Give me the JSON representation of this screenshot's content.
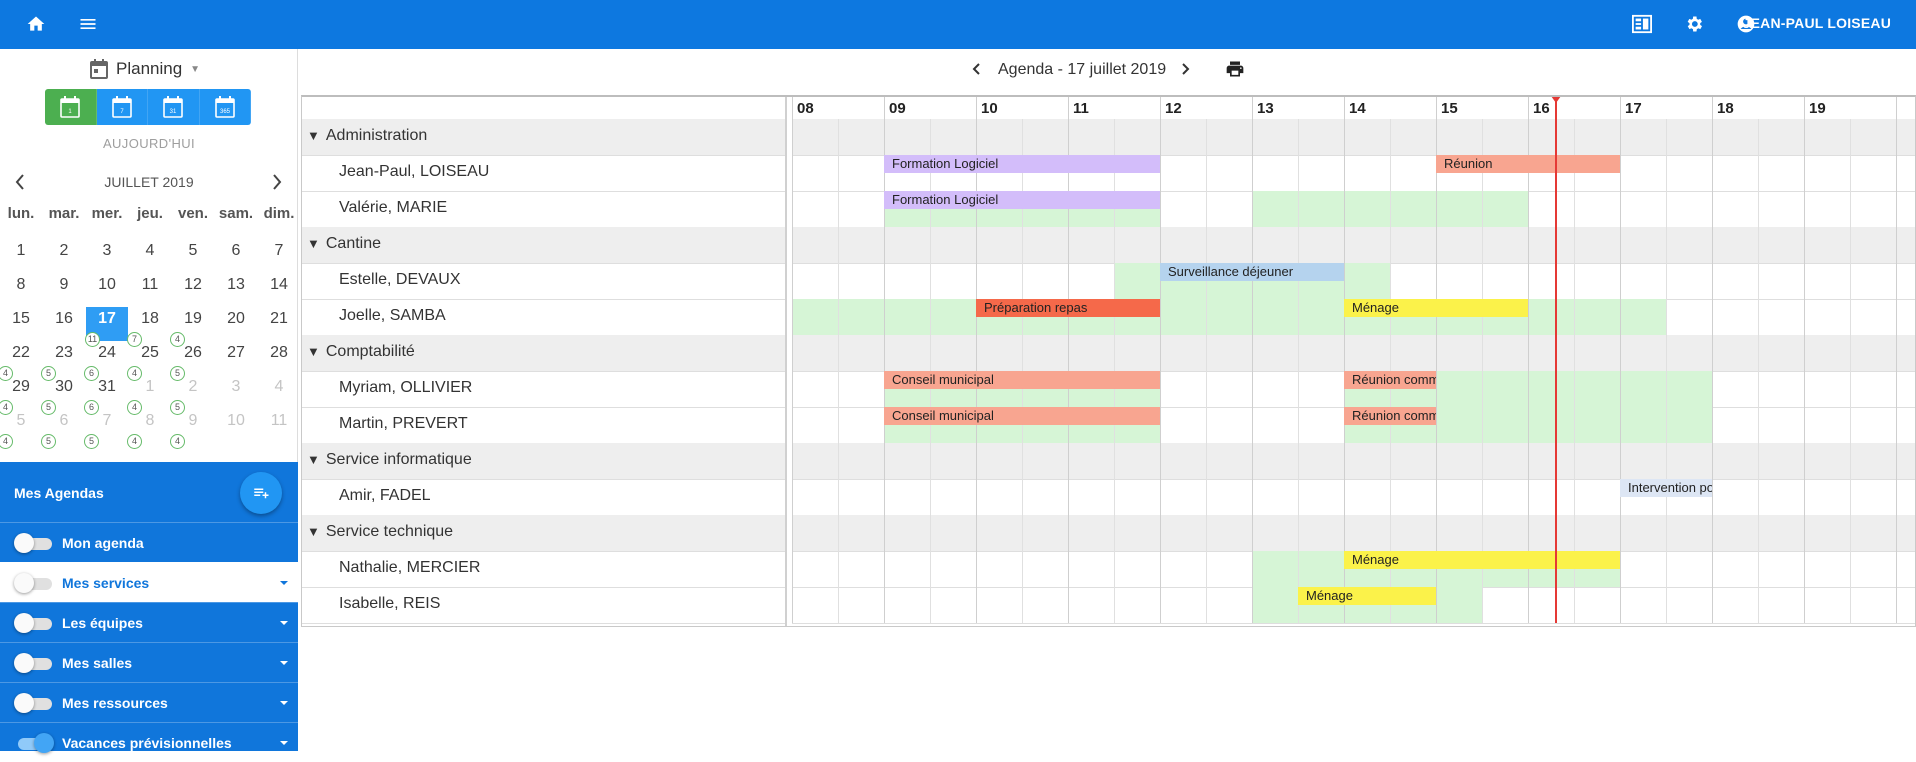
{
  "appbar": {
    "user_name": "JEAN-PAUL LOISEAU",
    "color": "#0d78e0"
  },
  "sidebar": {
    "view_select": "Planning",
    "view_buttons": [
      {
        "name": "day-view-button",
        "sub": "1",
        "active": true
      },
      {
        "name": "week-view-button",
        "sub": "7",
        "active": false
      },
      {
        "name": "month-view-button",
        "sub": "31",
        "active": false
      },
      {
        "name": "year-view-button",
        "sub": "365",
        "active": false
      }
    ],
    "today_label": "AUJOURD'HUI",
    "month_label": "JUILLET 2019",
    "weekdays": [
      "lun.",
      "mar.",
      "mer.",
      "jeu.",
      "ven.",
      "sam.",
      "dim."
    ],
    "weeks": [
      [
        {
          "d": "1"
        },
        {
          "d": "2"
        },
        {
          "d": "3"
        },
        {
          "d": "4"
        },
        {
          "d": "5"
        },
        {
          "d": "6"
        },
        {
          "d": "7"
        }
      ],
      [
        {
          "d": "8"
        },
        {
          "d": "9"
        },
        {
          "d": "10"
        },
        {
          "d": "11"
        },
        {
          "d": "12"
        },
        {
          "d": "13"
        },
        {
          "d": "14"
        }
      ],
      [
        {
          "d": "15"
        },
        {
          "d": "16"
        },
        {
          "d": "17",
          "today": true,
          "badge": "11"
        },
        {
          "d": "18",
          "badge": "7"
        },
        {
          "d": "19",
          "badge": "4"
        },
        {
          "d": "20"
        },
        {
          "d": "21"
        }
      ],
      [
        {
          "d": "22",
          "badge": "4"
        },
        {
          "d": "23",
          "badge": "5"
        },
        {
          "d": "24",
          "badge": "6"
        },
        {
          "d": "25",
          "badge": "4"
        },
        {
          "d": "26",
          "badge": "5"
        },
        {
          "d": "27"
        },
        {
          "d": "28"
        }
      ],
      [
        {
          "d": "29",
          "badge": "4"
        },
        {
          "d": "30",
          "badge": "5"
        },
        {
          "d": "31",
          "badge": "6"
        },
        {
          "d": "1",
          "other": true,
          "badge": "4"
        },
        {
          "d": "2",
          "other": true,
          "badge": "5"
        },
        {
          "d": "3",
          "other": true
        },
        {
          "d": "4",
          "other": true
        }
      ],
      [
        {
          "d": "5",
          "other": true,
          "badge": "4"
        },
        {
          "d": "6",
          "other": true,
          "badge": "5"
        },
        {
          "d": "7",
          "other": true,
          "badge": "5"
        },
        {
          "d": "8",
          "other": true,
          "badge": "4"
        },
        {
          "d": "9",
          "other": true,
          "badge": "4"
        },
        {
          "d": "10",
          "other": true
        },
        {
          "d": "11",
          "other": true
        }
      ]
    ],
    "mes_agendas_title": "Mes Agendas",
    "agendas": [
      {
        "label": "Mon agenda",
        "on": false,
        "caret": false,
        "selected": false
      },
      {
        "label": "Mes services",
        "on": false,
        "caret": true,
        "selected": true
      },
      {
        "label": "Les équipes",
        "on": false,
        "caret": true,
        "selected": false
      },
      {
        "label": "Mes salles",
        "on": false,
        "caret": true,
        "selected": false
      },
      {
        "label": "Mes ressources",
        "on": false,
        "caret": true,
        "selected": false
      },
      {
        "label": "Vacances prévisionnelles",
        "on": true,
        "caret": true,
        "selected": false
      }
    ]
  },
  "main": {
    "title": "Agenda - 17 juillet 2019",
    "hours": [
      "08",
      "09",
      "10",
      "11",
      "12",
      "13",
      "14",
      "15",
      "16",
      "17",
      "18",
      "19"
    ],
    "now_hour": 16.3,
    "groups": [
      {
        "name": "Administration",
        "people": [
          {
            "name": "Jean-Paul, LOISEAU",
            "avail": [],
            "events": [
              {
                "title": "Formation Logiciel",
                "start": 9,
                "end": 12,
                "color": "#d3bdfa"
              },
              {
                "title": "Réunion",
                "start": 15,
                "end": 17,
                "color": "#f8a590"
              }
            ]
          },
          {
            "name": "Valérie, MARIE",
            "avail": [
              [
                9,
                12
              ],
              [
                13,
                16
              ]
            ],
            "events": [
              {
                "title": "Formation Logiciel",
                "start": 9,
                "end": 12,
                "color": "#d3bdfa"
              }
            ]
          }
        ]
      },
      {
        "name": "Cantine",
        "people": [
          {
            "name": "Estelle, DEVAUX",
            "avail": [
              [
                11.5,
                14.5
              ]
            ],
            "events": [
              {
                "title": "Surveillance déjeuner",
                "start": 12,
                "end": 14,
                "color": "#b5d3ee"
              }
            ]
          },
          {
            "name": "Joelle, SAMBA",
            "avail": [
              [
                8,
                17.5
              ]
            ],
            "events": [
              {
                "title": "Préparation repas",
                "start": 10,
                "end": 12,
                "color": "#f5694a"
              },
              {
                "title": "Ménage",
                "start": 14,
                "end": 16,
                "color": "#fbf24a"
              }
            ]
          }
        ]
      },
      {
        "name": "Comptabilité",
        "people": [
          {
            "name": "Myriam, OLLIVIER",
            "avail": [
              [
                9,
                12
              ],
              [
                14,
                18
              ]
            ],
            "events": [
              {
                "title": "Conseil municipal",
                "start": 9,
                "end": 12,
                "color": "#f8a590"
              },
              {
                "title": "Réunion commission",
                "start": 14,
                "end": 15,
                "color": "#f8a590"
              }
            ]
          },
          {
            "name": "Martin, PREVERT",
            "avail": [
              [
                9,
                12
              ],
              [
                14,
                18
              ]
            ],
            "events": [
              {
                "title": "Conseil municipal",
                "start": 9,
                "end": 12,
                "color": "#f8a590"
              },
              {
                "title": "Réunion commission",
                "start": 14,
                "end": 15,
                "color": "#f8a590"
              }
            ]
          }
        ]
      },
      {
        "name": "Service informatique",
        "people": [
          {
            "name": "Amir, FADEL",
            "avail": [],
            "events": [
              {
                "title": "Intervention poste",
                "start": 17,
                "end": 18,
                "color": "#dde6f4"
              }
            ]
          }
        ]
      },
      {
        "name": "Service technique",
        "people": [
          {
            "name": "Nathalie, MERCIER",
            "avail": [
              [
                13,
                17
              ]
            ],
            "events": [
              {
                "title": "Ménage",
                "start": 14,
                "end": 17,
                "color": "#fbf24a"
              }
            ]
          },
          {
            "name": "Isabelle, REIS",
            "avail": [
              [
                13,
                15.5
              ]
            ],
            "events": [
              {
                "title": "Ménage",
                "start": 13.5,
                "end": 15,
                "color": "#fbf24a"
              }
            ]
          }
        ]
      }
    ]
  }
}
